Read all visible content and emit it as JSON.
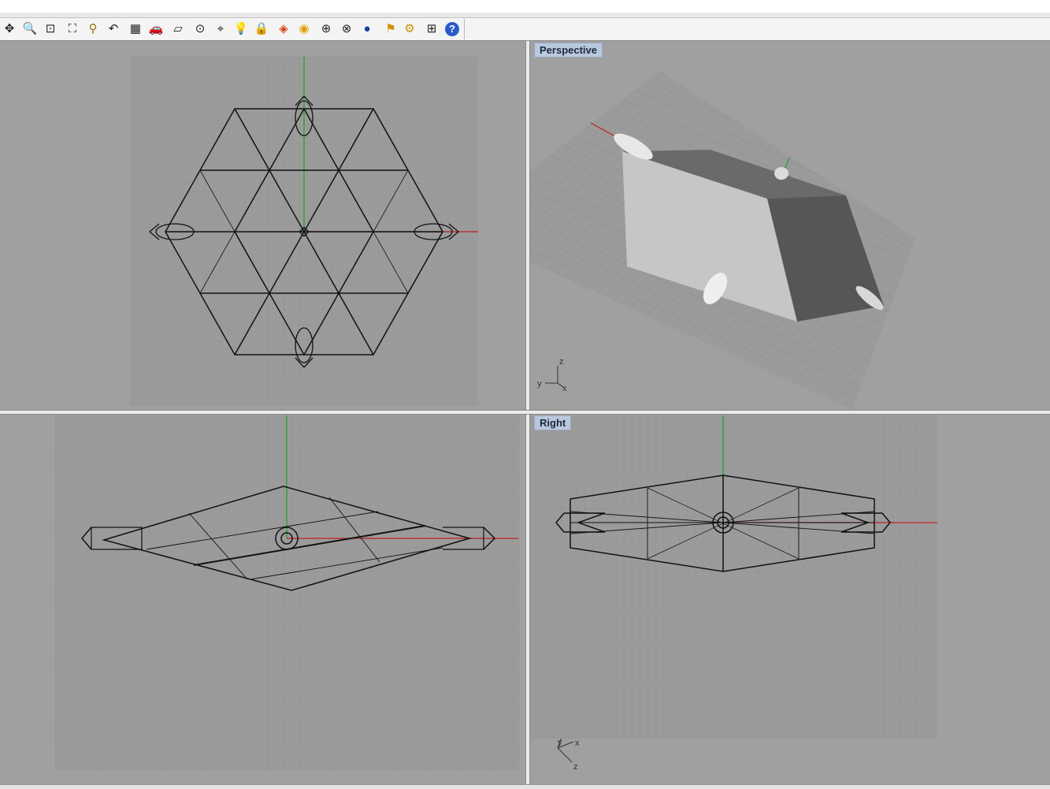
{
  "toolbar": {
    "icons": [
      "pan-icon",
      "zoom-dynamic-icon",
      "zoom-window-icon",
      "zoom-extents-icon",
      "zoom-selected-icon",
      "undo-view-icon",
      "four-viewports-icon",
      "car-icon",
      "plane-grid-icon",
      "target-icon",
      "osnap-icon",
      "light-bulb-icon",
      "lock-icon",
      "layer-icon",
      "color-wheel-icon",
      "wireframe-sphere-icon",
      "mesh-sphere-icon",
      "render-sphere-icon",
      "flag-icon",
      "gear-icon",
      "network-icon",
      "help-icon"
    ]
  },
  "viewports": {
    "top": {
      "label": ""
    },
    "perspective": {
      "label": "Perspective"
    },
    "front": {
      "label": ""
    },
    "right": {
      "label": "Right"
    }
  },
  "axes": {
    "perspective": {
      "z": "z",
      "y": "y",
      "x": "x"
    },
    "right": {
      "y": "y",
      "x": "x",
      "z": "z"
    }
  },
  "colors": {
    "viewport_bg": "#a0a0a0",
    "grid_bg": "#9a9a9a",
    "x_axis": "#c02020",
    "y_axis": "#20a020",
    "wire": "#111111",
    "label_bg": "#b9c8dc"
  }
}
